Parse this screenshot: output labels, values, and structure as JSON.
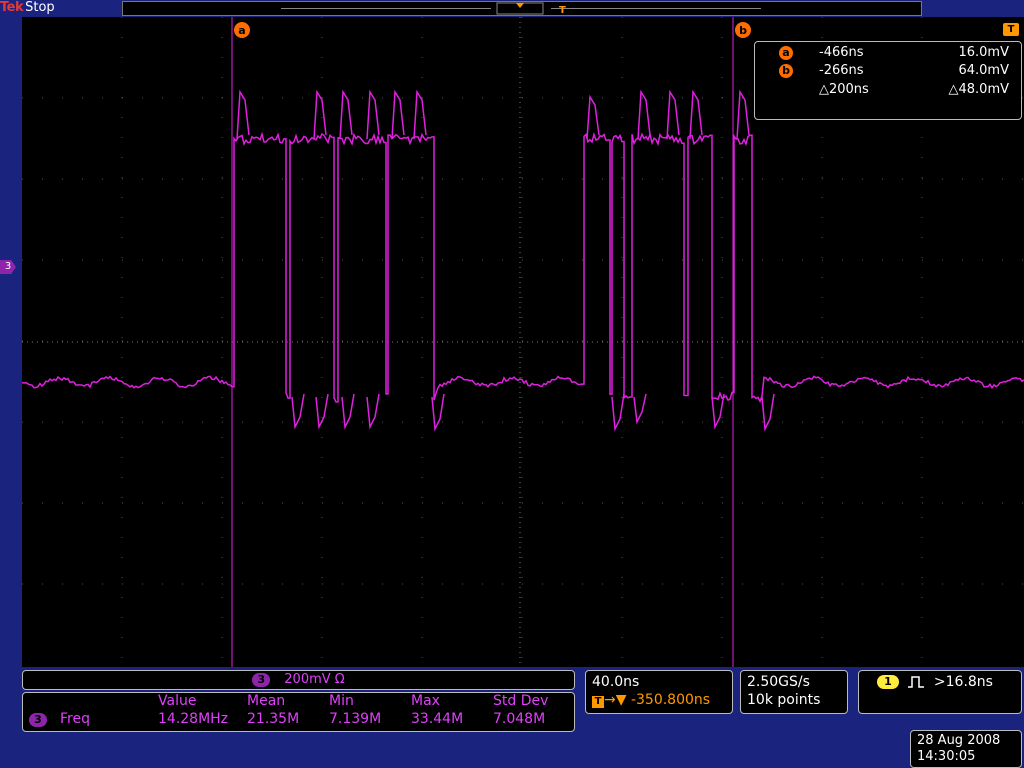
{
  "header": {
    "brand": "Tek",
    "state": "Stop"
  },
  "cursors": {
    "a": {
      "label": "a",
      "time": "-466ns",
      "value": "16.0mV"
    },
    "b": {
      "label": "b",
      "time": "-266ns",
      "value": "64.0mV"
    },
    "delta": {
      "time": "△200ns",
      "value": "△48.0mV"
    }
  },
  "channel_marker": "3",
  "trigger_marker": "T",
  "scale_bar": {
    "channel": "3",
    "text": "200mV Ω"
  },
  "measurement": {
    "channel": "3",
    "name": "Freq",
    "headers": [
      "Value",
      "Mean",
      "Min",
      "Max",
      "Std Dev"
    ],
    "values": [
      "14.28MHz",
      "21.35M",
      "7.139M",
      "33.44M",
      "7.048M"
    ]
  },
  "timebase": {
    "scale": "40.0ns",
    "position": "-350.800ns"
  },
  "acquisition": {
    "rate": "2.50GS/s",
    "record": "10k points"
  },
  "trigger": {
    "source": "1",
    "level": ">16.8ns"
  },
  "datetime": {
    "date": "28 Aug 2008",
    "time": "14:30:05"
  },
  "colors": {
    "trace": "#e020e0",
    "cursor": "#ff6d00",
    "background": "#1a237e",
    "grid": "#777777"
  },
  "icons": {
    "pulse": "pulse-width-trigger-icon"
  }
}
